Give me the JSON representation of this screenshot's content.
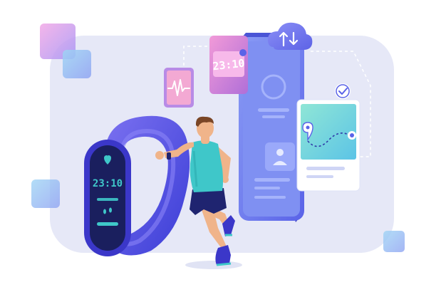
{
  "scene": {
    "band_time": "23:10",
    "card_time": "23:10",
    "icons": [
      "heart-icon",
      "pulse-icon",
      "footsteps-icon",
      "cloud-sync-icon",
      "check-icon",
      "map-pin-icon",
      "user-icon"
    ]
  },
  "colors": {
    "background_panel": "#e6e8f7",
    "phone": "#6a7ef0",
    "band": "#4d4fe0",
    "band_screen": "#1a1f5e",
    "accent_teal": "#3fc7c9",
    "card_pink": "#d67fd7"
  }
}
